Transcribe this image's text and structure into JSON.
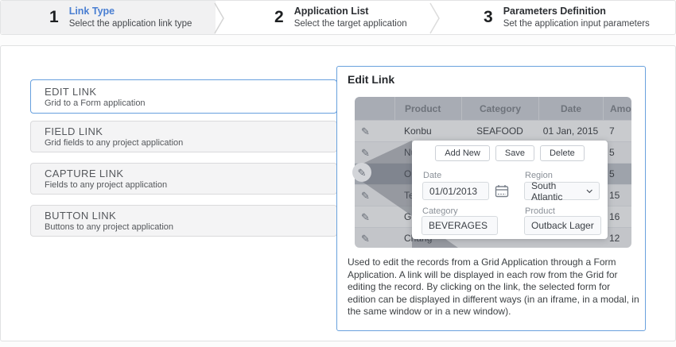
{
  "steps": [
    {
      "number": "1",
      "title": "Link Type",
      "subtitle": "Select the application link type",
      "active": true
    },
    {
      "number": "2",
      "title": "Application List",
      "subtitle": "Select the target application",
      "active": false
    },
    {
      "number": "3",
      "title": "Parameters Definition",
      "subtitle": "Set the application input parameters",
      "active": false
    }
  ],
  "link_types": [
    {
      "title": "EDIT LINK",
      "subtitle": "Grid to a Form application",
      "selected": true
    },
    {
      "title": "FIELD LINK",
      "subtitle": "Grid fields to any project application",
      "selected": false
    },
    {
      "title": "CAPTURE LINK",
      "subtitle": "Fields to any project application",
      "selected": false
    },
    {
      "title": "BUTTON LINK",
      "subtitle": "Buttons to any project application",
      "selected": false
    }
  ],
  "preview": {
    "title": "Edit Link",
    "table": {
      "headers": {
        "icon": "",
        "product": "Product",
        "category": "Category",
        "date": "Date",
        "amount": "Amount"
      },
      "rows": [
        {
          "product": "Konbu",
          "category": "SEAFOOD",
          "date": "01 Jan, 2015",
          "amount": "7",
          "selected": false
        },
        {
          "product": "NuNuCa",
          "category": "",
          "date": "",
          "amount": "5",
          "selected": false
        },
        {
          "product": "Outback",
          "category": "",
          "date": "",
          "amount": "5",
          "selected": true
        },
        {
          "product": "Teatime",
          "category": "",
          "date": "",
          "amount": "15",
          "selected": false
        },
        {
          "product": "Gorgon",
          "category": "",
          "date": "",
          "amount": "16",
          "selected": false
        },
        {
          "product": "Chang",
          "category": "",
          "date": "",
          "amount": "12",
          "selected": false
        }
      ]
    },
    "popup": {
      "buttons": {
        "add_new": "Add New",
        "save": "Save",
        "delete": "Delete"
      },
      "fields": {
        "date": {
          "label": "Date",
          "value": "01/01/2013"
        },
        "region": {
          "label": "Region",
          "value": "South Atlantic"
        },
        "category": {
          "label": "Category",
          "value": "BEVERAGES"
        },
        "product": {
          "label": "Product",
          "value": "Outback Lager"
        }
      }
    },
    "description": "Used to edit the records from a Grid Application through a Form Application. A link will be displayed in each row from the Grid for editing the record. By clicking on the link, the selected form for edition can be displayed in different ways (in an iframe, in a modal, in the same window or in a new window)."
  },
  "colors": {
    "accent_blue": "#4a7fd2",
    "panel_border_blue": "#69a1dd",
    "step_active_bg": "#f1f1f2",
    "table_header_bg": "#a8acb4",
    "table_row_bg": "#c9cbce",
    "table_row_selected_bg": "#9ea3ab",
    "beam_overlay": "rgba(88,94,105,0.42)"
  }
}
